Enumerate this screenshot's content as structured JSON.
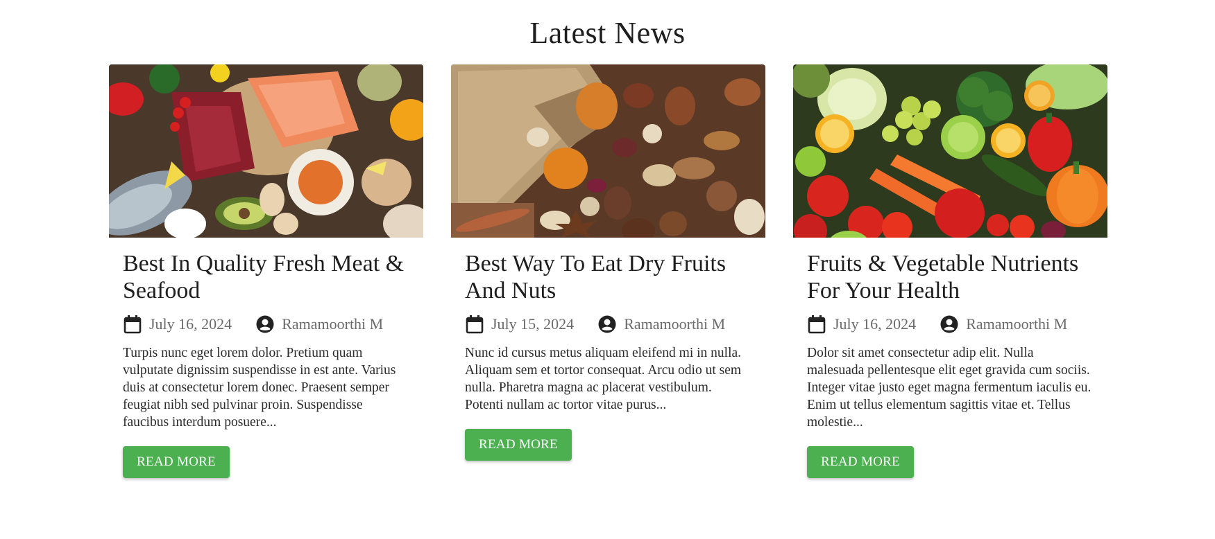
{
  "section": {
    "title": "Latest News"
  },
  "accent_color": "#4caf50",
  "cards": [
    {
      "image_alt": "meat-seafood-photo",
      "title": "Best In Quality Fresh Meat & Seafood",
      "date": "July 16, 2024",
      "author": "Ramamoorthi M",
      "excerpt": "Turpis nunc eget lorem dolor. Pretium quam vulputate dignissim suspendisse in est ante. Varius duis at consectetur lorem donec. Praesent semper feugiat nibh sed pulvinar proin. Suspendisse faucibus interdum posuere...",
      "button": "READ MORE"
    },
    {
      "image_alt": "dry-fruits-nuts-photo",
      "title": "Best Way To Eat Dry Fruits And Nuts",
      "date": "July 15, 2024",
      "author": "Ramamoorthi M",
      "excerpt": "Nunc id cursus metus aliquam eleifend mi in nulla. Aliquam sem et tortor consequat. Arcu odio ut sem nulla. Pharetra magna ac placerat vestibulum. Potenti nullam ac tortor vitae purus...",
      "button": "READ MORE"
    },
    {
      "image_alt": "fruits-vegetables-photo",
      "title": "Fruits & Vegetable Nutrients For Your Health",
      "date": "July 16, 2024",
      "author": "Ramamoorthi M",
      "excerpt": "Dolor sit amet consectetur adip elit. Nulla malesuada pellentesque elit eget gravida cum sociis. Integer vitae justo eget magna fermentum iaculis eu. Enim ut tellus elementum sagittis vitae et. Tellus molestie...",
      "button": "READ MORE"
    }
  ]
}
